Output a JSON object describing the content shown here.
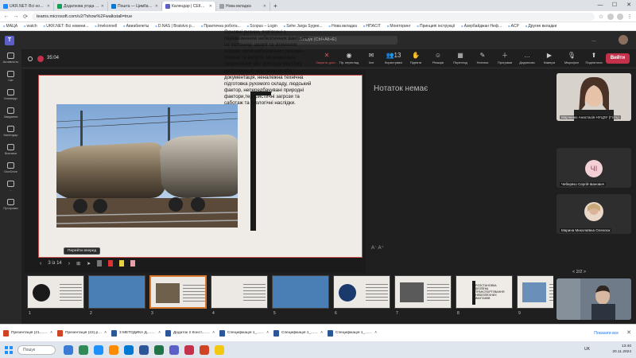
{
  "browser": {
    "tabs": [
      {
        "label": "UKR.NET: Всі новини України, о...",
        "color": "#1a8cff"
      },
      {
        "label": "Додаткова угода штампи • тип...",
        "color": "#0f9d58"
      },
      {
        "label": "Пошта — Цимбал Богдан Мико...",
        "color": "#0078d4"
      },
      {
        "label": "Календар | СЕКЦІЯ УЕ Зусь...",
        "color": "#5b5fc7",
        "active": true
      },
      {
        "label": "Нова вкладка",
        "color": "#9aa0a6"
      }
    ],
    "url": "teams.microsoft.com/v2/?show%2Fwalkstall=true",
    "bookmarks": [
      "МАЦА",
      "watch",
      "UKR.NET: Всі новини...",
      "Imekonnell",
      "Авиабилеты",
      "D.NAS | Bratstvo p...",
      "Практична робота...",
      "Scopus – Login",
      "Sehe Jarga Sygee...",
      "Нова вкладка",
      "НПАСІТ",
      "Моніторинг",
      "Принципі інструкції",
      "Азербайджан Неф...",
      "АСР",
      "Другие вкладки"
    ]
  },
  "teams": {
    "logo": "T",
    "search_placeholder": "Пошук (Ctrl+Alt+E)",
    "more": "...",
    "timer": "35:04",
    "rail": [
      {
        "label": "Активність",
        "icon": "bell-icon"
      },
      {
        "label": "Чат",
        "icon": "chat-icon"
      },
      {
        "label": "Команди",
        "icon": "teams-icon"
      },
      {
        "label": "Завдання",
        "icon": "tasks-icon"
      },
      {
        "label": "Календар",
        "icon": "calendar-icon"
      },
      {
        "label": "Виклики",
        "icon": "phone-icon"
      },
      {
        "label": "OneDrive",
        "icon": "cloud-icon"
      },
      {
        "label": "...",
        "icon": "more-icon"
      },
      {
        "label": "Програми",
        "icon": "apps-icon"
      }
    ],
    "toolbar": [
      {
        "label": "Закрити дост...",
        "glyph": "✕",
        "red": true
      },
      {
        "label": "Пр. перегляд",
        "glyph": "◉"
      },
      {
        "label": "Чат",
        "glyph": "✉"
      },
      {
        "label": "Користувачі",
        "glyph": "👥",
        "count": "13"
      },
      {
        "label": "Підняти",
        "glyph": "✋"
      },
      {
        "label": "Реакція",
        "glyph": "☺"
      },
      {
        "label": "Перегляд",
        "glyph": "▦"
      },
      {
        "label": "Нотатки",
        "glyph": "✎"
      },
      {
        "label": "Програми",
        "glyph": "＋"
      },
      {
        "label": "Додатково",
        "glyph": "…"
      },
      {
        "label": "Камера",
        "glyph": "▶"
      },
      {
        "label": "Мікрофон",
        "glyph": "🎙"
      },
      {
        "label": "Поділитися",
        "glyph": "⬆"
      }
    ],
    "leave_label": "Вийти"
  },
  "slide": {
    "text": "Основні ризики, пов'язані з перевезенням небезпечних вантажів на залізниці: аварії та зіткнення поїздів, витік небезпечних речовин, пожежі та вибухи, неправильне закріплення або фіксація вантажу, неправильне маркування або документація, неналежна технічна підготовка рухомого складу, людський фактор, непередбачувані природні фактори,терористичні загрози та саботаж та екологічні наслідки.",
    "notes_label": "Нотаток немає",
    "font_size_controls": "A⁻  A⁺",
    "tooltip": "Перейти вперед",
    "counter": "3 із 14"
  },
  "thumbnails": [
    {
      "num": "1",
      "kind": "logo"
    },
    {
      "num": "2",
      "kind": "train-photo"
    },
    {
      "num": "3",
      "kind": "tank-photo",
      "active": true
    },
    {
      "num": "4",
      "kind": "text"
    },
    {
      "num": "5",
      "kind": "train-photo"
    },
    {
      "num": "6",
      "kind": "logo-text"
    },
    {
      "num": "7",
      "kind": "people-photo"
    },
    {
      "num": "8",
      "kind": "title",
      "title": "РОЗСТАНОВКА БЕЗПЕКА ТРАНСПОРТУВАННЯ НЕБЕЗПЕЧНИХ ВАНТАЖІВ"
    },
    {
      "num": "9",
      "kind": "crane"
    }
  ],
  "participants": [
    {
      "name": "Марченко Анастасія НУЦЗУ (Гість)",
      "kind": "video-woman"
    },
    {
      "name": "Чеберяко Сергій Іванович",
      "kind": "initials",
      "initials": "ЧІ"
    },
    {
      "name": "Марина Миколаївна Олексюк",
      "kind": "avatar"
    },
    {
      "name": "",
      "kind": "video-man"
    }
  ],
  "pager": "< 2/2 >",
  "downloads": {
    "items": [
      {
        "label": "Презентація (21.....pptx",
        "color": "#d04423"
      },
      {
        "label": "Презентація (22).pptx",
        "color": "#d04423"
      },
      {
        "label": "3 МЕТОДИКА Д....docx",
        "color": "#2b579a"
      },
      {
        "label": "Додаток 2 Конст....docx",
        "color": "#2b579a"
      },
      {
        "label": "Специфікація 1_....docx",
        "color": "#2b579a"
      },
      {
        "label": "Специфікація 1_....docx",
        "color": "#2b579a"
      },
      {
        "label": "Специфікація 1_....docx",
        "color": "#2b579a"
      }
    ],
    "show_all": "Показати все",
    "close": "✕"
  },
  "taskbar": {
    "search": "Пошук",
    "apps": [
      "#3a7bd5",
      "#2e8b57",
      "#1e90ff",
      "#ff8c00",
      "#0078d4",
      "#2b579a",
      "#217346",
      "#5b5fc7",
      "#c4314b",
      "#d04423",
      "#f2c811"
    ],
    "lang": "UK",
    "time": "13:40",
    "date": "20.11.2024"
  }
}
